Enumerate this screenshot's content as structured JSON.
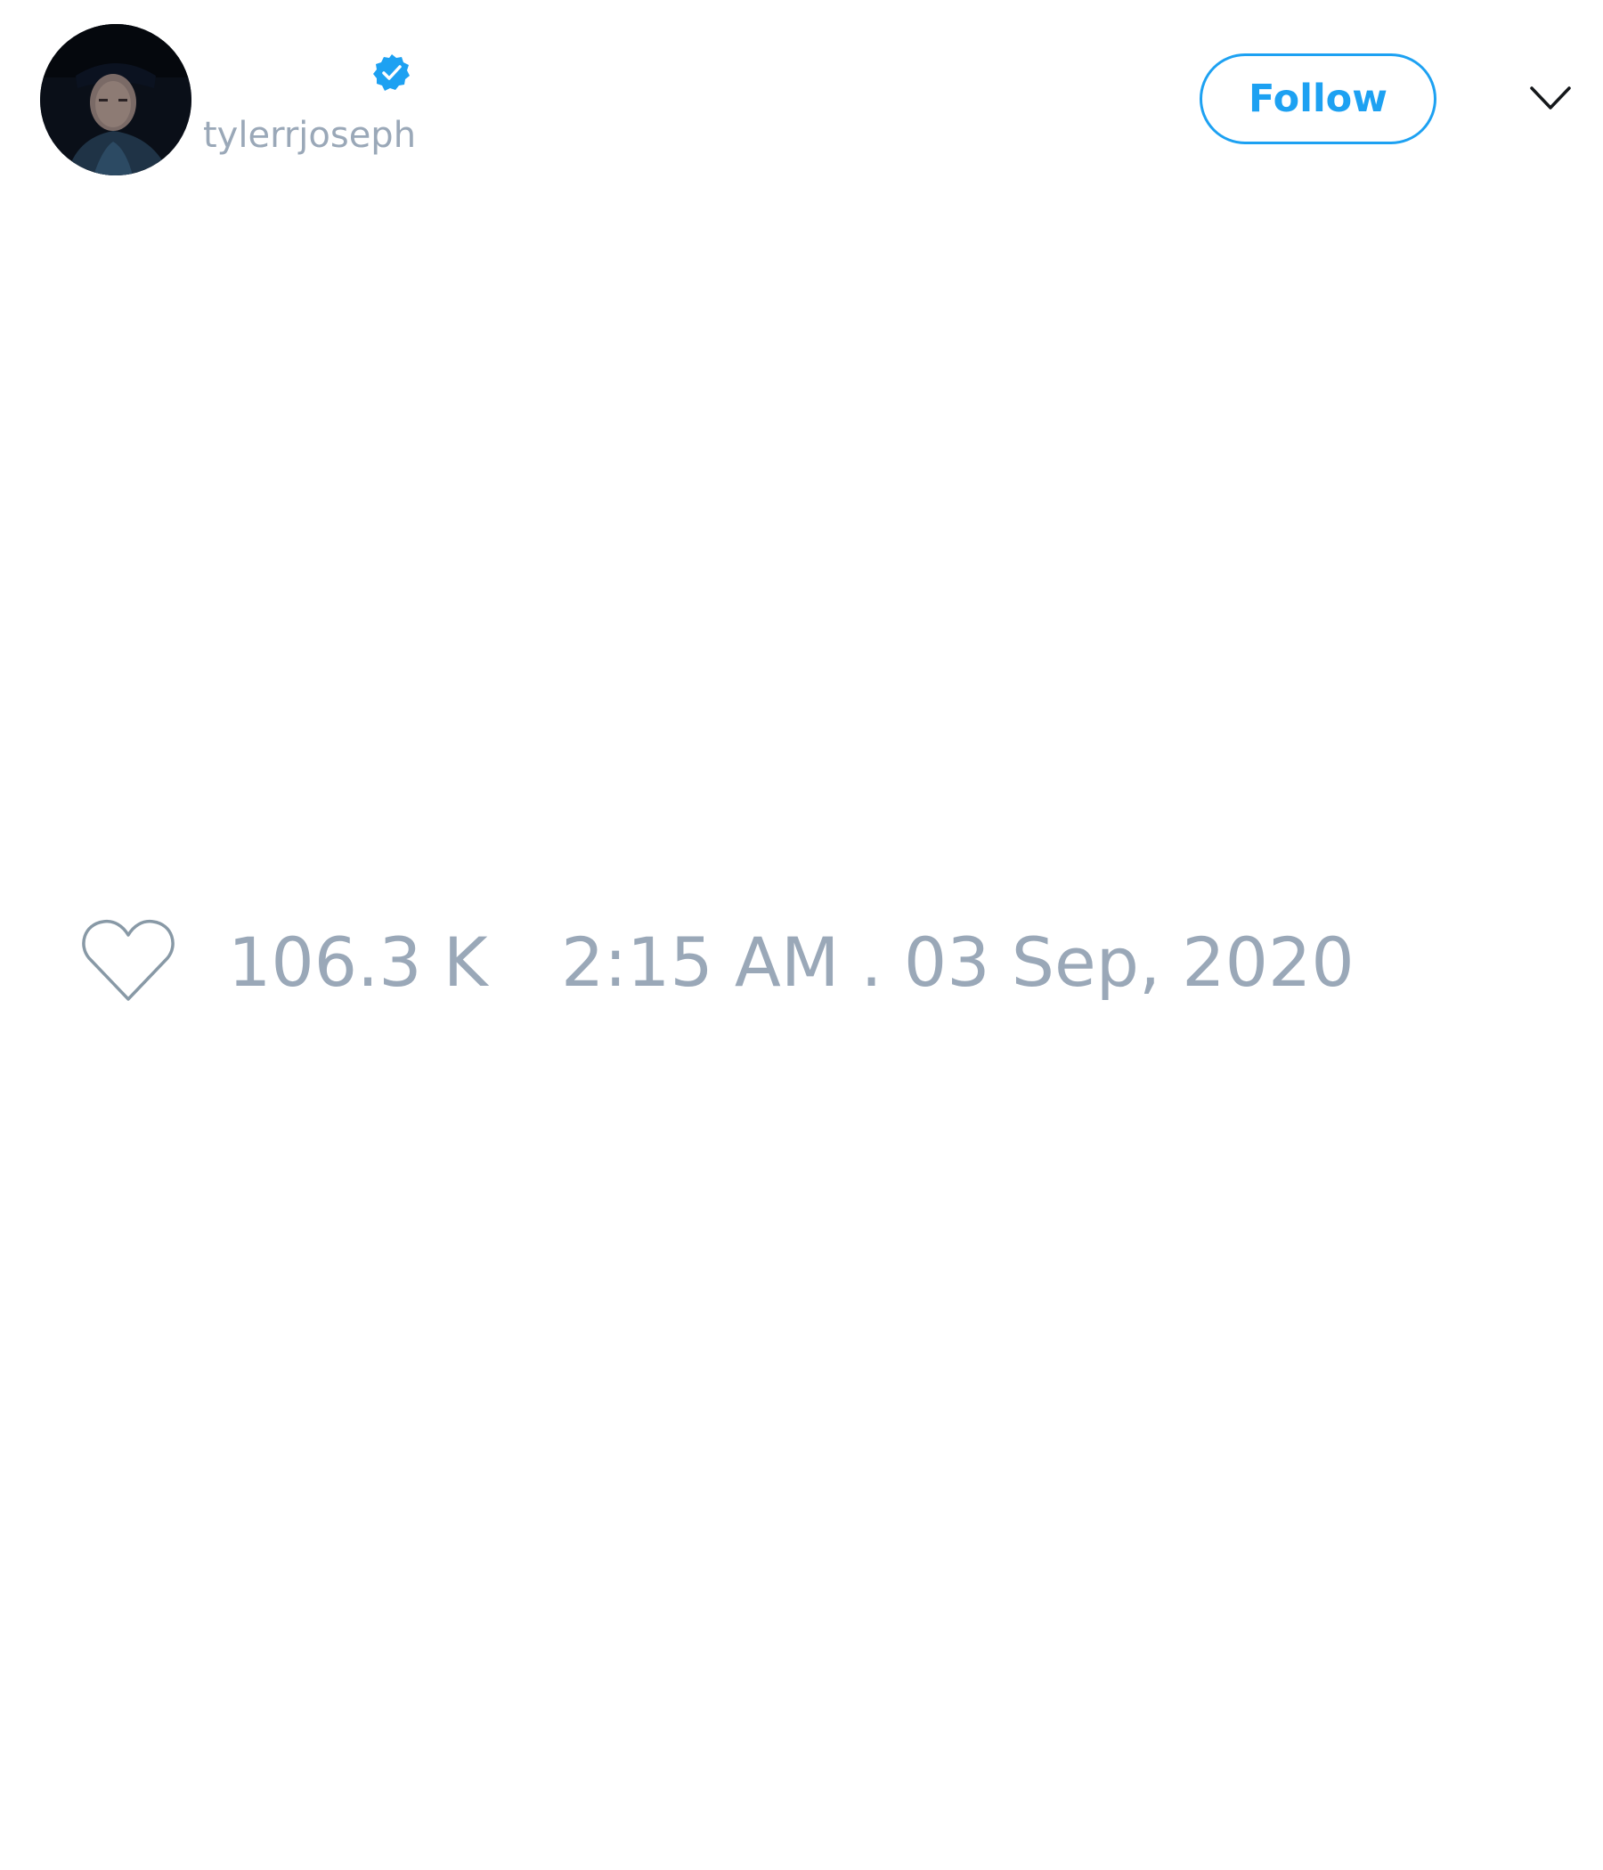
{
  "tweet": {
    "author": {
      "handle": "tylerrjoseph",
      "verified": true
    },
    "follow_button": {
      "label": "Follow"
    },
    "stats": {
      "like_count": "106.3 K",
      "timestamp": "2:15 AM . 03 Sep, 2020"
    }
  },
  "icons": {
    "verified": "verified-badge-icon",
    "menu": "chevron-down-icon",
    "like": "heart-icon"
  },
  "colors": {
    "accent": "#1da1f2",
    "muted_text": "#9aa8b8",
    "icon_gray": "#8899a6",
    "background": "#ffffff"
  }
}
